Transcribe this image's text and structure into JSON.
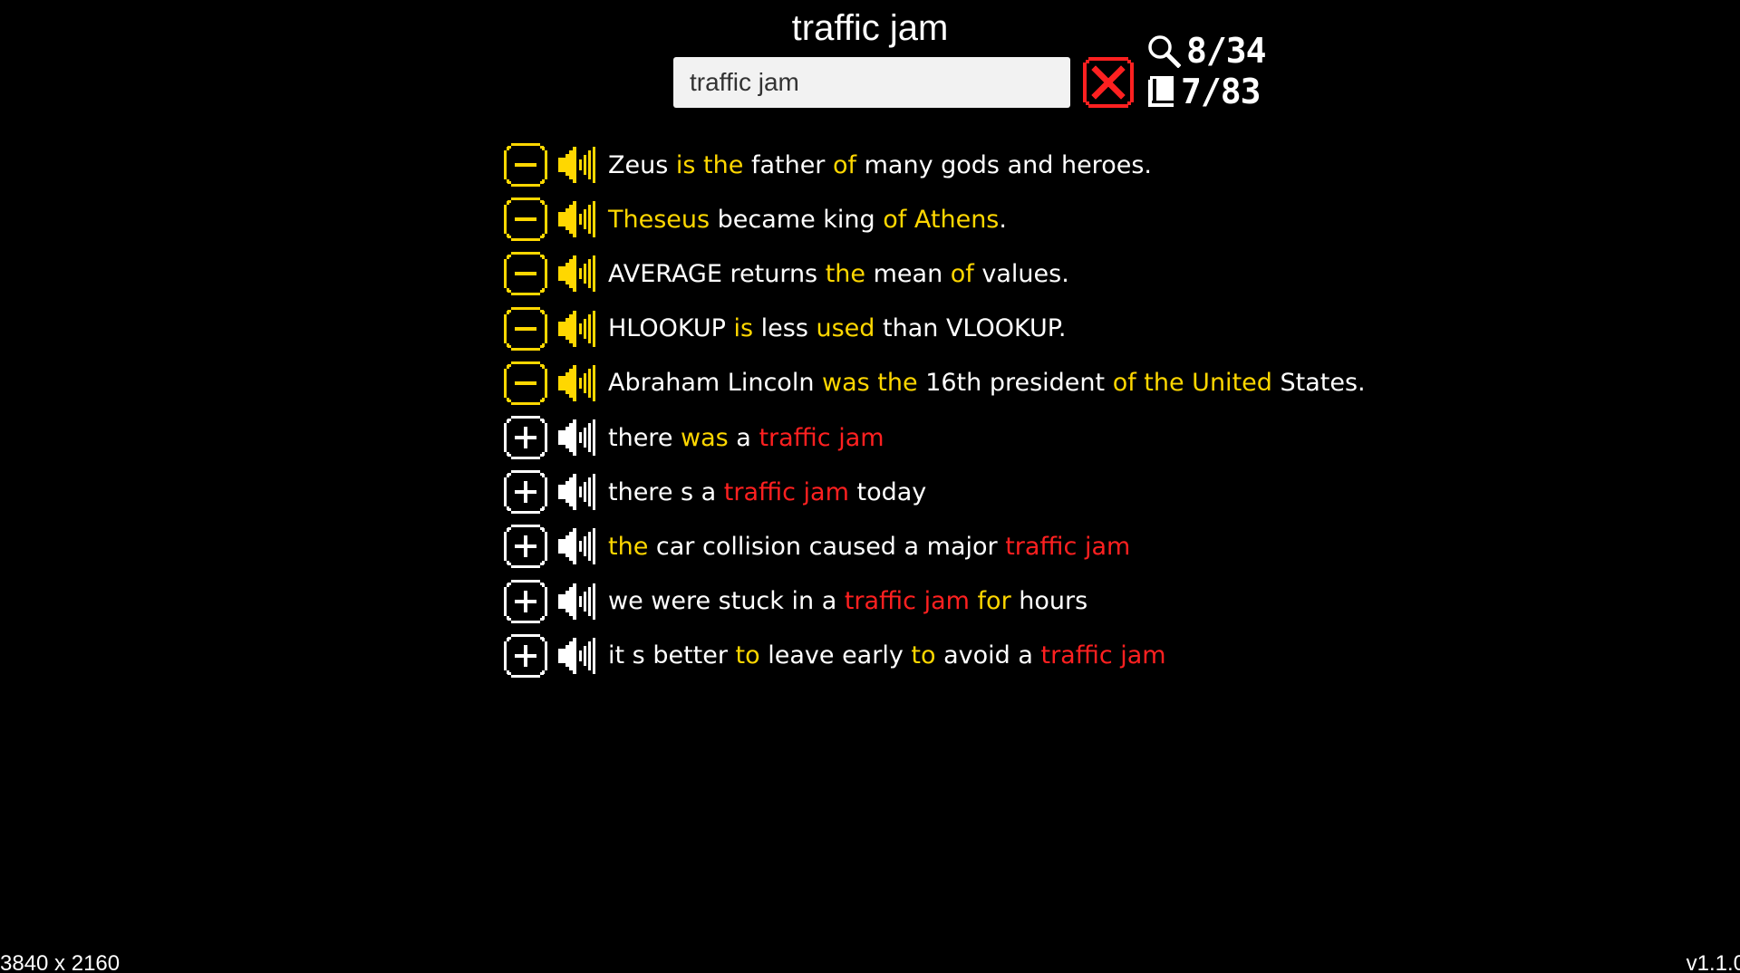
{
  "header": {
    "title": "traffic jam"
  },
  "search": {
    "value": "traffic jam",
    "placeholder": ""
  },
  "stats": {
    "search_count": "8/34",
    "book_count": "7/83"
  },
  "footer": {
    "resolution": "3840 x 2160",
    "version": "v1.1.0"
  },
  "colors": {
    "background": "#000000",
    "normal_text": "#ffffff",
    "function_word": "#ffd700",
    "match": "#ff2020",
    "added_state": "#ffd700",
    "available_state": "#ffffff",
    "clear_button": "#ff2020"
  },
  "icons": {
    "remove": "minus-icon",
    "add": "plus-icon",
    "audio": "speaker-icon",
    "search": "magnifier-icon",
    "book": "book-icon",
    "clear": "x-icon"
  },
  "sentences": [
    {
      "state": "added",
      "tokens": [
        {
          "t": "Zeus",
          "c": "normal"
        },
        {
          "t": " ",
          "c": "normal"
        },
        {
          "t": "is the",
          "c": "function"
        },
        {
          "t": " father ",
          "c": "normal"
        },
        {
          "t": "of",
          "c": "function"
        },
        {
          "t": " many gods and heroes.",
          "c": "normal"
        }
      ]
    },
    {
      "state": "added",
      "tokens": [
        {
          "t": "Theseus",
          "c": "function"
        },
        {
          "t": " became king ",
          "c": "normal"
        },
        {
          "t": "of Athens",
          "c": "function"
        },
        {
          "t": ".",
          "c": "normal"
        }
      ]
    },
    {
      "state": "added",
      "tokens": [
        {
          "t": "AVERAGE returns ",
          "c": "normal"
        },
        {
          "t": "the",
          "c": "function"
        },
        {
          "t": " mean ",
          "c": "normal"
        },
        {
          "t": "of",
          "c": "function"
        },
        {
          "t": " values.",
          "c": "normal"
        }
      ]
    },
    {
      "state": "added",
      "tokens": [
        {
          "t": "HLOOKUP ",
          "c": "normal"
        },
        {
          "t": "is",
          "c": "function"
        },
        {
          "t": " less ",
          "c": "normal"
        },
        {
          "t": "used",
          "c": "function"
        },
        {
          "t": " than VLOOKUP.",
          "c": "normal"
        }
      ]
    },
    {
      "state": "added",
      "tokens": [
        {
          "t": "Abraham Lincoln ",
          "c": "normal"
        },
        {
          "t": "was the",
          "c": "function"
        },
        {
          "t": " 16th president ",
          "c": "normal"
        },
        {
          "t": "of the United",
          "c": "function"
        },
        {
          "t": " States.",
          "c": "normal"
        }
      ]
    },
    {
      "state": "available",
      "tokens": [
        {
          "t": "there ",
          "c": "normal"
        },
        {
          "t": "was",
          "c": "function"
        },
        {
          "t": " a ",
          "c": "normal"
        },
        {
          "t": "traffic jam",
          "c": "match"
        }
      ]
    },
    {
      "state": "available",
      "tokens": [
        {
          "t": "there s a ",
          "c": "normal"
        },
        {
          "t": "traffic jam",
          "c": "match"
        },
        {
          "t": " today",
          "c": "normal"
        }
      ]
    },
    {
      "state": "available",
      "tokens": [
        {
          "t": "the",
          "c": "function"
        },
        {
          "t": " car collision caused a major ",
          "c": "normal"
        },
        {
          "t": "traffic jam",
          "c": "match"
        }
      ]
    },
    {
      "state": "available",
      "tokens": [
        {
          "t": "we were stuck in a ",
          "c": "normal"
        },
        {
          "t": "traffic jam",
          "c": "match"
        },
        {
          "t": " ",
          "c": "normal"
        },
        {
          "t": "for",
          "c": "function"
        },
        {
          "t": " hours",
          "c": "normal"
        }
      ]
    },
    {
      "state": "available",
      "tokens": [
        {
          "t": "it s better ",
          "c": "normal"
        },
        {
          "t": "to",
          "c": "function"
        },
        {
          "t": " leave early ",
          "c": "normal"
        },
        {
          "t": "to",
          "c": "function"
        },
        {
          "t": " avoid a ",
          "c": "normal"
        },
        {
          "t": "traffic jam",
          "c": "match"
        }
      ]
    }
  ]
}
